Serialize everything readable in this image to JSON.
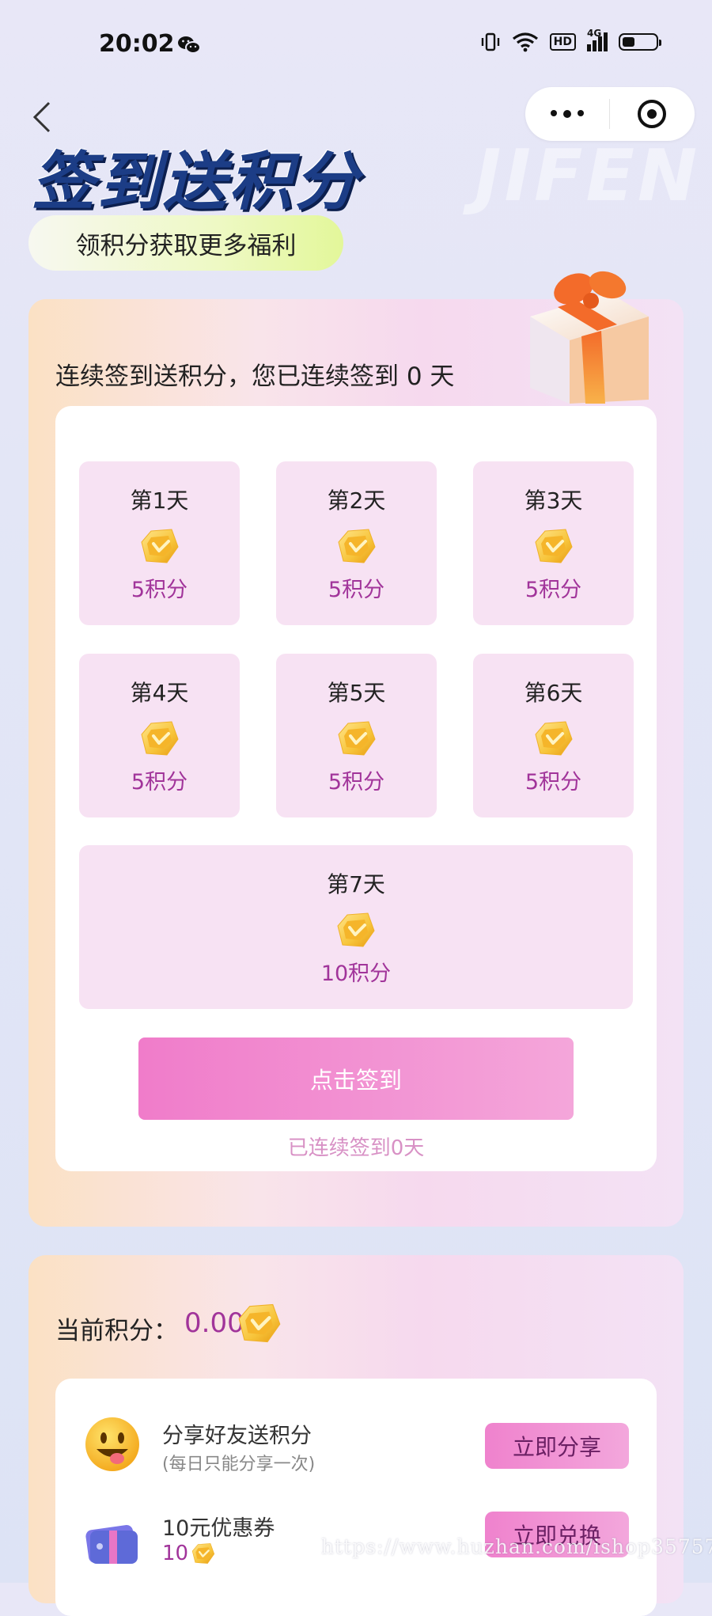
{
  "status_bar": {
    "time": "20:02",
    "wechat_icon": "wechat-icon",
    "vibrate_icon": "vibrate-icon",
    "wifi_icon": "wifi-icon",
    "hd_label": "HD",
    "network_label": "4G",
    "battery_level": 0.38
  },
  "nav": {
    "back_icon": "chevron-left-icon",
    "more_icon": "more-dots-icon",
    "close_icon": "target-circle-icon"
  },
  "hero": {
    "title": "签到送积分",
    "deco_text": "JIFEN",
    "subtitle": "领积分获取更多福利"
  },
  "checkin": {
    "heading": "连续签到送积分，您已连续签到 0 天",
    "days": [
      {
        "label": "第1天",
        "points": "5积分"
      },
      {
        "label": "第2天",
        "points": "5积分"
      },
      {
        "label": "第3天",
        "points": "5积分"
      },
      {
        "label": "第4天",
        "points": "5积分"
      },
      {
        "label": "第5天",
        "points": "5积分"
      },
      {
        "label": "第6天",
        "points": "5积分"
      },
      {
        "label": "第7天",
        "points": "10积分"
      }
    ],
    "button_label": "点击签到",
    "streak_note": "已连续签到0天"
  },
  "points": {
    "label": "当前积分：",
    "value": "0.00"
  },
  "tasks": [
    {
      "title": "分享好友送积分",
      "subtitle": "(每日只能分享一次)",
      "button": "立即分享",
      "icon": "smiley-face-icon"
    },
    {
      "title": "10元优惠券",
      "cost": "10",
      "button": "立即兑换",
      "icon": "coupon-card-icon"
    }
  ],
  "watermark": "https://www.huzhan.com/ishop35757",
  "colors": {
    "accent_pink": "#f07cca",
    "points_purple": "#a1349a",
    "title_blue": "#1c3d86",
    "day_tile": "#f7e2f3"
  }
}
